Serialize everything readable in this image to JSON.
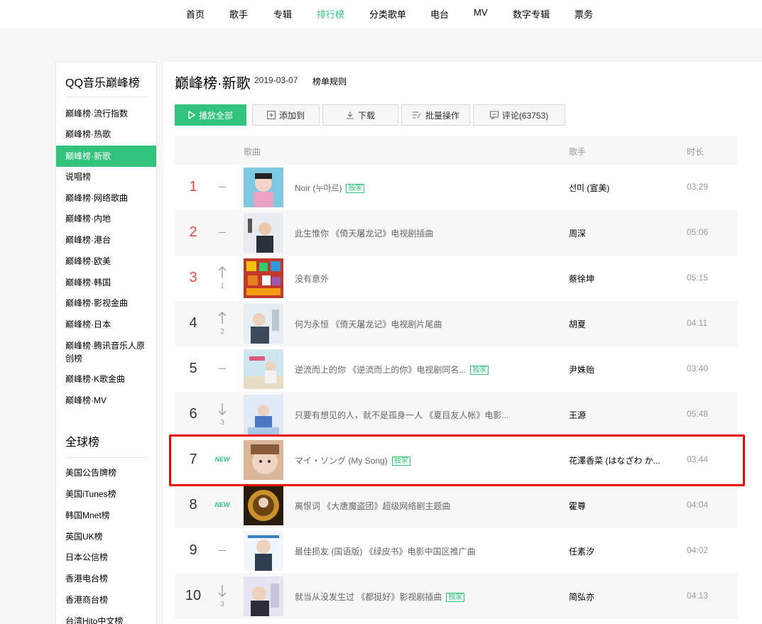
{
  "nav": [
    {
      "label": "首页"
    },
    {
      "label": "歌手"
    },
    {
      "label": "专辑"
    },
    {
      "label": "排行榜",
      "active": true
    },
    {
      "label": "分类歌单"
    },
    {
      "label": "电台"
    },
    {
      "label": "MV"
    },
    {
      "label": "数字专辑"
    },
    {
      "label": "票务"
    }
  ],
  "sidebar": {
    "section1_title": "QQ音乐巅峰榜",
    "section1_items": [
      "巅峰榜·流行指数",
      "巅峰榜·热歌",
      "巅峰榜·新歌",
      "说唱榜",
      "巅峰榜·网络歌曲",
      "巅峰榜·内地",
      "巅峰榜·港台",
      "巅峰榜·欧美",
      "巅峰榜·韩国",
      "巅峰榜·影视金曲",
      "巅峰榜·日本",
      "巅峰榜·腾讯音乐人原创榜",
      "巅峰榜·K歌金曲",
      "巅峰榜·MV"
    ],
    "section2_title": "全球榜",
    "section2_items": [
      "美国公告牌榜",
      "美国iTunes榜",
      "韩国Mnet榜",
      "英国UK榜",
      "日本公信榜",
      "香港电台榜",
      "香港商台榜",
      "台湾Hito中文榜"
    ]
  },
  "header": {
    "title": "巅峰榜·新歌",
    "date": "2019-03-07",
    "rule_link": "榜单规则"
  },
  "toolbar": {
    "play_all": "播放全部",
    "add_to": "添加到",
    "download": "下载",
    "batch": "批量操作",
    "comments": "评论(63753)"
  },
  "columns": {
    "song": "歌曲",
    "singer": "歌手",
    "duration": "时长"
  },
  "songs": [
    {
      "rank": "1",
      "trend": "flat",
      "change": "",
      "title": "Noir (누아르)",
      "exclusive": true,
      "singer": "선미 (宣美)",
      "duration": "03:29"
    },
    {
      "rank": "2",
      "trend": "flat",
      "change": "",
      "title": "此生惟你  《倚天屠龙记》电视剧插曲",
      "exclusive": false,
      "singer": "周深",
      "duration": "05:06"
    },
    {
      "rank": "3",
      "trend": "up",
      "change": "1",
      "title": "没有意外",
      "exclusive": false,
      "singer": "蔡徐坤",
      "duration": "05:15"
    },
    {
      "rank": "4",
      "trend": "up",
      "change": "2",
      "title": "何为永恒  《倚天屠龙记》电视剧片尾曲",
      "exclusive": false,
      "singer": "胡夏",
      "duration": "04:11"
    },
    {
      "rank": "5",
      "trend": "flat",
      "change": "",
      "title": "逆流而上的你  《逆流而上的你》电视剧同名...",
      "exclusive": true,
      "singer": "尹姝贻",
      "duration": "03:40"
    },
    {
      "rank": "6",
      "trend": "down",
      "change": "3",
      "title": "只要有想见的人，就不是孤身一人  《夏目友人帐》电影...",
      "exclusive": false,
      "singer": "王源",
      "duration": "05:48"
    },
    {
      "rank": "7",
      "trend": "new",
      "change": "NEW",
      "title": "マイ・ソング (My Song)",
      "exclusive": true,
      "singer": "花澤香菜 (はなざわ か...",
      "duration": "03:44"
    },
    {
      "rank": "8",
      "trend": "new",
      "change": "NEW",
      "title": "离恨词  《大唐魔盗团》超级网络剧主题曲",
      "exclusive": false,
      "singer": "霍尊",
      "duration": "04:04"
    },
    {
      "rank": "9",
      "trend": "flat",
      "change": "",
      "title": "最佳损友 (国语版)  《绿皮书》电影中国区推广曲",
      "exclusive": false,
      "singer": "任素汐",
      "duration": "04:02"
    },
    {
      "rank": "10",
      "trend": "down",
      "change": "3",
      "title": "就当从没发生过  《都挺好》影视剧插曲",
      "exclusive": true,
      "singer": "简弘亦",
      "duration": "04:13"
    }
  ],
  "exclusive_tag": "独家",
  "colors": {
    "accent": "#31c27c",
    "top_rank": "#e04b3a",
    "highlight": "#ee0000"
  }
}
